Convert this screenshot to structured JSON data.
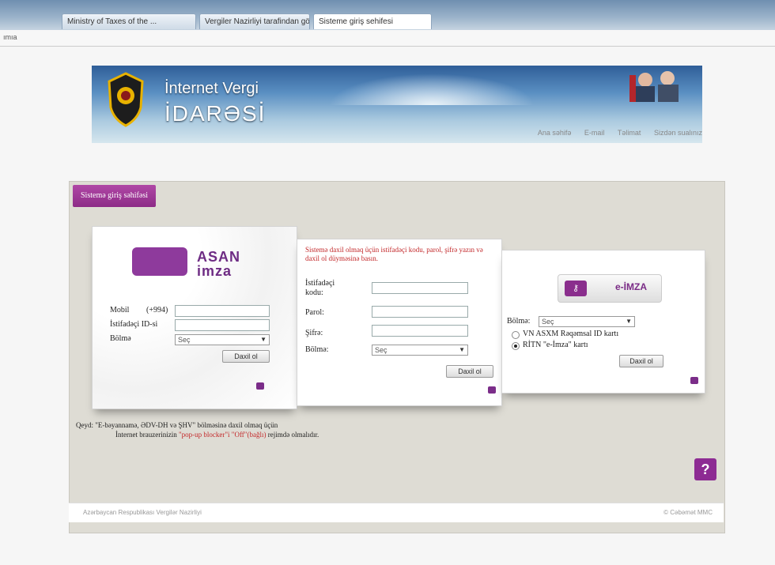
{
  "browser": {
    "tabs": [
      "Ministry of Taxes of the ...",
      "Vergiler Nazirliyi tarafindan gö...",
      "Sisteme giriş sehifesi"
    ],
    "address_fragment": "ımıa"
  },
  "header": {
    "title_line1": "İnternet Vergi",
    "title_line2": "İDARƏSİ",
    "links": [
      "Ana səhifə",
      "E-mail",
      "Təlimat",
      "Sizdən sualınız"
    ]
  },
  "panel": {
    "tab_label": "Sistemə giriş səhifəsi",
    "asan": {
      "logo_line1": "ASAN",
      "logo_line2": "imza",
      "mobile_label": "Mobil",
      "prefix": "(+994)",
      "userid_label": "İstifadəçi ID-si",
      "section_label": "Bölmə",
      "section_value": "Seç",
      "enter_button": "Daxil ol"
    },
    "login": {
      "info": "Sistemə daxil olmaq üçün istifadəçi kodu, parol, şifrə yazın və daxil ol düyməsinə basın.",
      "user_code_label": "İstifadəçi kodu:",
      "password_label": "Parol:",
      "pin_label": "Şifrə:",
      "section_label": "Bölmə:",
      "section_value": "Seç",
      "enter_button": "Daxil ol"
    },
    "eimza": {
      "title": "e-İMZA",
      "section_label": "Bölmə:",
      "section_value": "Seç",
      "option1": "VN ASXM Rəqəmsal ID kartı",
      "option2": "RİTN \"e-İmza\" kartı",
      "enter_button": "Daxil ol"
    },
    "note_line1": "Qeyd: \"E-bəyannamə, ƏDV-DH və ŞHV\" bölməsinə daxil olmaq üçün",
    "note_line2_pre": "İnternet brauzerinizin ",
    "note_line2_red": "\"pop-up blocker\"i \"Off\"(bağlı)",
    "note_line2_post": " rejimdə olmalıdır."
  },
  "footer": {
    "left": "Azərbaycan Respublikası Vergilər Nazirliyi",
    "right": "© Cəbəmət MMC"
  },
  "colors": {
    "accent": "#8d2b93",
    "red": "#c3282a"
  }
}
